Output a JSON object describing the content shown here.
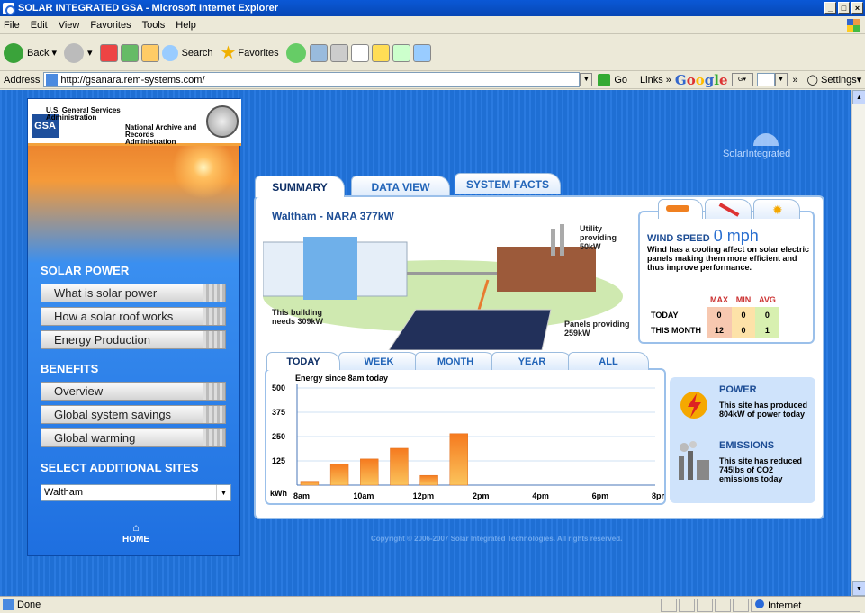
{
  "window": {
    "title": "SOLAR INTEGRATED GSA - Microsoft Internet Explorer"
  },
  "menu": [
    "File",
    "Edit",
    "View",
    "Favorites",
    "Tools",
    "Help"
  ],
  "toolbar": {
    "back": "Back",
    "search": "Search",
    "favorites": "Favorites"
  },
  "address": {
    "label": "Address",
    "url": "http://gsanara.rem-systems.com/",
    "go": "Go",
    "links": "Links",
    "google": "Google",
    "settings": "Settings"
  },
  "status": {
    "text": "Done",
    "zone": "Internet"
  },
  "sidebar": {
    "gsa_logo": "GSA",
    "gsa_line1": "U.S. General Services Administration",
    "gsa_line2": "National Archive and Records Administration",
    "solar_head": "SOLAR POWER",
    "solar_items": [
      "What is solar power",
      "How a solar roof works",
      "Energy Production"
    ],
    "benefits_head": "BENEFITS",
    "benefits_items": [
      "Overview",
      "Global system savings",
      "Global warming"
    ],
    "sites_head": "SELECT ADDITIONAL SITES",
    "site_selected": "Waltham",
    "home": "HOME"
  },
  "brand": "SolarIntegrated",
  "tabs": [
    "SUMMARY",
    "DATA VIEW",
    "SYSTEM FACTS"
  ],
  "summary": {
    "site_title": "Waltham - NARA 377kW",
    "utility": "Utility providing 50kW",
    "building": "This building needs 309kW",
    "panels": "Panels providing 259kW"
  },
  "weather": {
    "wind_label": "WIND SPEED",
    "wind_value": "0 mph",
    "description": "Wind has a cooling affect on solar electric panels making them more efficient and thus improve performance.",
    "col_max": "MAX",
    "col_min": "MIN",
    "col_avg": "AVG",
    "rows": [
      {
        "label": "TODAY",
        "max": "0",
        "min": "0",
        "avg": "0"
      },
      {
        "label": "THIS MONTH",
        "max": "12",
        "min": "0",
        "avg": "1"
      }
    ]
  },
  "period_tabs": [
    "TODAY",
    "WEEK",
    "MONTH",
    "YEAR",
    "ALL"
  ],
  "power": {
    "head": "POWER",
    "text": "This site has produced 804kW of power today"
  },
  "emissions": {
    "head": "EMISSIONS",
    "text": "This site has reduced 745lbs of CO2 emissions today"
  },
  "copyright": "Copyright © 2006-2007 Solar Integrated Technologies. All rights reserved.",
  "chart_data": {
    "type": "bar",
    "title": "Energy since 8am today",
    "ylabel": "kWh",
    "ylim": [
      0,
      500
    ],
    "yticks": [
      "500",
      "375",
      "250",
      "125"
    ],
    "xticks": [
      "8am",
      "10am",
      "12pm",
      "2pm",
      "4pm",
      "6pm",
      "8pm"
    ],
    "x": [
      8,
      9,
      10,
      11,
      12,
      13
    ],
    "values": [
      20,
      110,
      135,
      190,
      50,
      265
    ],
    "color": "#f0902a"
  }
}
